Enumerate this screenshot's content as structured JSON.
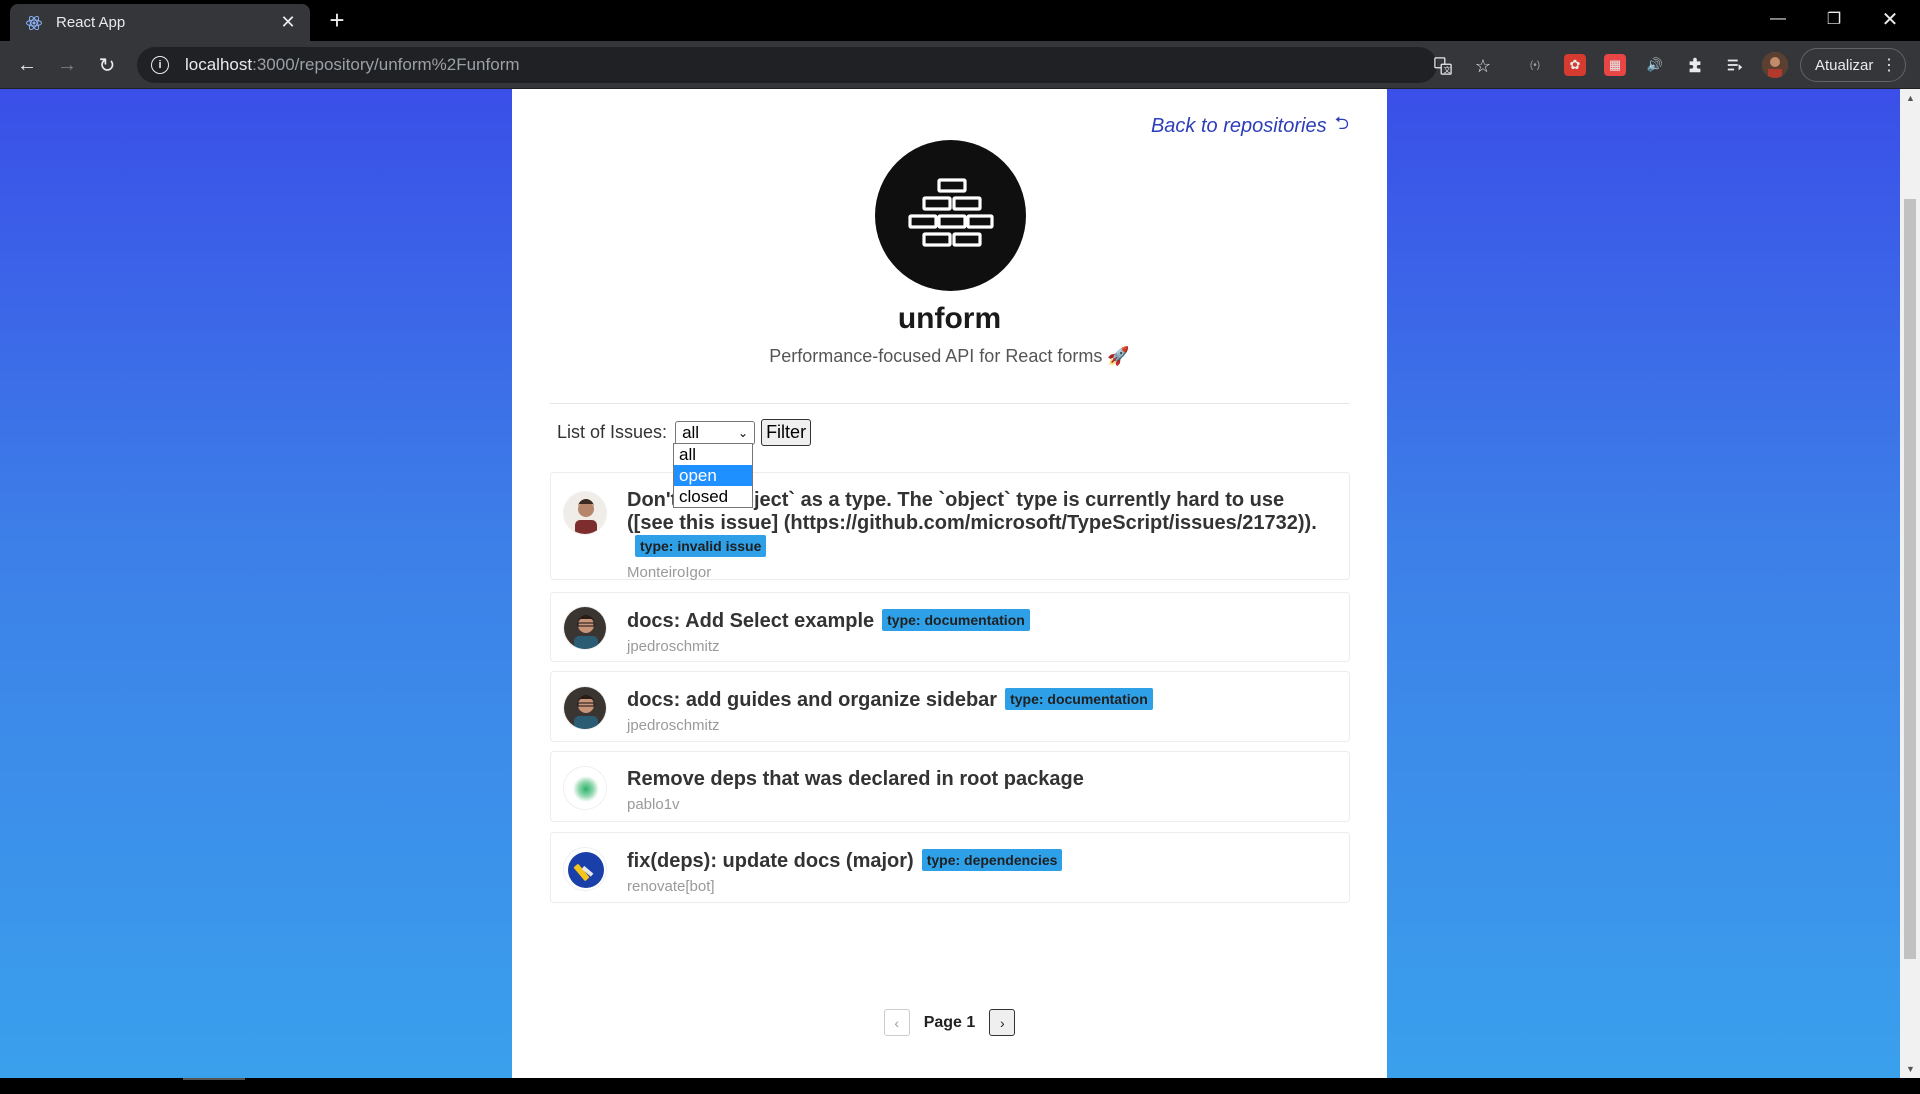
{
  "browser": {
    "tab_title": "React App",
    "url_host": "localhost",
    "url_path": ":3000/repository/unform%2Funform",
    "update_label": "Atualizar"
  },
  "page": {
    "back_link": "Back to repositories",
    "repo_name": "unform",
    "repo_description": "Performance-focused API for React forms",
    "description_emoji": "🚀",
    "filter_label": "List of Issues:",
    "filter_selected": "all",
    "filter_button": "Filter",
    "filter_options": [
      "all",
      "open",
      "closed"
    ],
    "highlighted_option": "open",
    "page_label": "Page 1"
  },
  "issues": [
    {
      "title": "Don't use `object` as a type. The `object` type is currently hard to use ([see this issue] (https://github.com/microsoft/TypeScript/issues/21732)).",
      "label": "type: invalid issue",
      "user": "MonteiroIgor"
    },
    {
      "title": "docs: Add Select example",
      "label": "type: documentation",
      "user": "jpedroschmitz"
    },
    {
      "title": "docs: add guides and organize sidebar",
      "label": "type: documentation",
      "user": "jpedroschmitz"
    },
    {
      "title": "Remove deps that was declared in root package",
      "label": "",
      "user": "pablo1v"
    },
    {
      "title": "fix(deps): update docs (major)",
      "label": "type: dependencies",
      "user": "renovate[bot]"
    }
  ],
  "colors": {
    "label_bg": "#2ea0e8",
    "link": "#2d3eb8",
    "bg_top": "#3a4fe8",
    "bg_bottom": "#3aa0ec"
  }
}
